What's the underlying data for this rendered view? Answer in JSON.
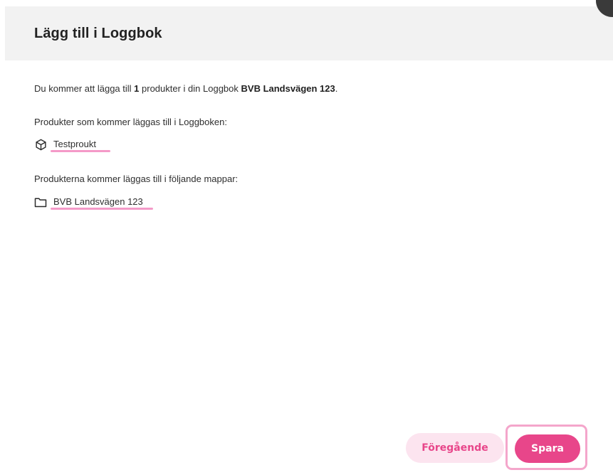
{
  "dialog": {
    "title": "Lägg till i Loggbok",
    "intro": {
      "prefix": "Du kommer att lägga till ",
      "count": "1",
      "middle": " produkter i din Loggbok ",
      "logbook_name": "BVB Landsvägen 123",
      "suffix": "."
    },
    "products_heading": "Produkter som kommer läggas till i Loggboken:",
    "products": [
      {
        "label": "Testproukt",
        "icon": "cube-icon"
      }
    ],
    "folders_heading": "Produkterna kommer läggas till i följande mappar:",
    "folders": [
      {
        "label": "BVB Landsvägen 123",
        "icon": "folder-icon"
      }
    ],
    "buttons": {
      "previous": "Föregående",
      "save": "Spara"
    }
  },
  "colors": {
    "accent": "#e8468a",
    "accent_light": "#fce4ef",
    "underline": "#f49ac8",
    "header_bg": "#f2f2f2"
  }
}
